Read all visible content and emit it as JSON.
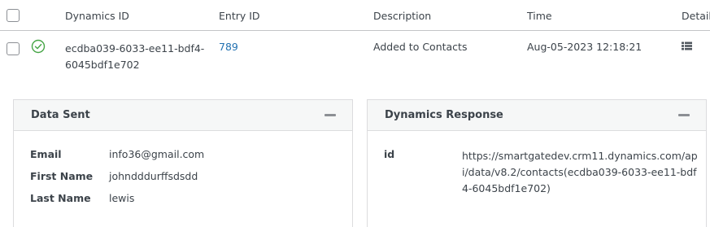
{
  "table": {
    "headers": {
      "dynamics_id": "Dynamics ID",
      "entry_id": "Entry ID",
      "description": "Description",
      "time": "Time",
      "details": "Details"
    },
    "rows": [
      {
        "dynamics_id": "ecdba039-6033-ee11-bdf4-6045bdf1e702",
        "entry_id": "789",
        "description": "Added to Contacts",
        "time": "Aug-05-2023 12:18:21",
        "status_icon": "check-circle-icon",
        "detail_icon": "list-icon"
      }
    ]
  },
  "data_sent": {
    "title": "Data Sent",
    "fields": [
      {
        "key": "Email",
        "value": "info36@gmail.com"
      },
      {
        "key": "First Name",
        "value": "johndddurffsdsdd"
      },
      {
        "key": "Last Name",
        "value": "lewis"
      }
    ]
  },
  "dynamics_response": {
    "title": "Dynamics Response",
    "fields": [
      {
        "key": "id",
        "value": "https://smartgatedev.crm11.dynamics.com/api/data/v8.2/contacts(ecdba039-6033-ee11-bdf4-6045bdf1e702)"
      }
    ]
  },
  "colors": {
    "link": "#2271b1",
    "success": "#46a546",
    "border": "#c3c4c7",
    "panel_header": "#f6f7f7"
  }
}
